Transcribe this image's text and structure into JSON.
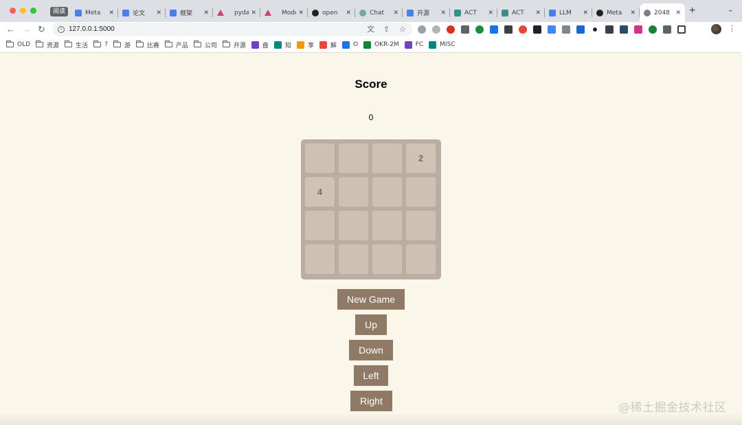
{
  "browser": {
    "tab_group_label": "阅读",
    "tabs": [
      {
        "title": "Meta",
        "icon": "doc-icon"
      },
      {
        "title": "论文",
        "icon": "doc-icon"
      },
      {
        "title": "框架",
        "icon": "doc-icon"
      },
      {
        "title": "pydan",
        "icon": "triangle-logo-icon"
      },
      {
        "title": "Mode",
        "icon": "triangle-logo-icon"
      },
      {
        "title": "open",
        "icon": "github-icon"
      },
      {
        "title": "Chat",
        "icon": "chatgpt-icon"
      },
      {
        "title": "开源",
        "icon": "doc-icon"
      },
      {
        "title": "ACT",
        "icon": "act-icon"
      },
      {
        "title": "ACT",
        "icon": "act-icon"
      },
      {
        "title": "LLM",
        "icon": "doc-icon"
      },
      {
        "title": "Meta",
        "icon": "github-icon"
      },
      {
        "title": "2048",
        "icon": "globe-icon",
        "active": true
      }
    ],
    "url": "127.0.0.1:5000",
    "bookmarks": [
      {
        "label": "OLD",
        "type": "folder"
      },
      {
        "label": "资源",
        "type": "folder"
      },
      {
        "label": "生活",
        "type": "folder"
      },
      {
        "label": "?",
        "type": "folder"
      },
      {
        "label": "游",
        "type": "folder"
      },
      {
        "label": "比赛",
        "type": "folder"
      },
      {
        "label": "产品",
        "type": "folder"
      },
      {
        "label": "公司",
        "type": "folder"
      },
      {
        "label": "开源",
        "type": "folder"
      },
      {
        "label": "盘",
        "type": "site"
      },
      {
        "label": "知",
        "type": "site"
      },
      {
        "label": "享",
        "type": "site"
      },
      {
        "label": "解",
        "type": "site"
      },
      {
        "label": "O",
        "type": "site"
      },
      {
        "label": "OKR-2M",
        "type": "site"
      },
      {
        "label": "FC",
        "type": "site"
      },
      {
        "label": "MISC",
        "type": "site"
      }
    ]
  },
  "game": {
    "score_title": "Score",
    "score_value": "0",
    "board": [
      [
        "",
        "",
        "",
        "2"
      ],
      [
        "4",
        "",
        "",
        ""
      ],
      [
        "",
        "",
        "",
        ""
      ],
      [
        "",
        "",
        "",
        ""
      ]
    ],
    "buttons": {
      "new_game": "New Game",
      "up": "Up",
      "down": "Down",
      "left": "Left",
      "right": "Right"
    },
    "colors": {
      "background": "#faf7ea",
      "board": "#bbada0",
      "empty_cell": "#cdc1b4",
      "button": "#8f7a66",
      "tile_text": "#776e65"
    }
  },
  "watermark": "@稀土掘金技术社区"
}
